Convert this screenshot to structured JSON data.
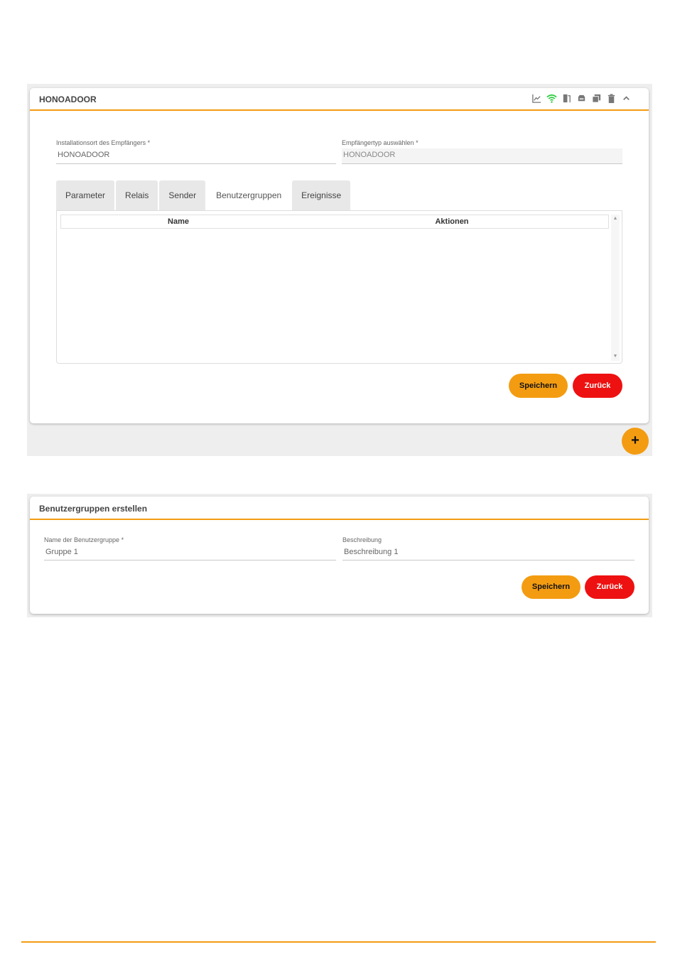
{
  "receiver_card": {
    "title": "HONOADOOR",
    "header_icons": [
      "chart-icon",
      "wifi-icon",
      "door-icon",
      "device-icon",
      "copy-icon",
      "trash-icon",
      "chevron-up-icon"
    ],
    "install_location_label": "Installationsort des Empfängers *",
    "install_location_value": "HONOADOOR",
    "receiver_type_label": "Empfängertyp auswählen *",
    "receiver_type_value": "HONOADOOR",
    "tabs": [
      {
        "label": "Parameter"
      },
      {
        "label": "Relais"
      },
      {
        "label": "Sender"
      },
      {
        "label": "Benutzergruppen",
        "active": true
      },
      {
        "label": "Ereignisse"
      }
    ],
    "table": {
      "columns": [
        "Name",
        "Aktionen"
      ],
      "rows": []
    },
    "save_label": "Speichern",
    "back_label": "Zurück",
    "fab_label": "+"
  },
  "create_group_card": {
    "title": "Benutzergruppen erstellen",
    "name_label": "Name der Benutzergruppe *",
    "name_value": "Gruppe 1",
    "description_label": "Beschreibung",
    "description_value": "Beschreibung 1",
    "save_label": "Speichern",
    "back_label": "Zurück"
  },
  "colors": {
    "accent": "#f39c12",
    "danger": "#ee1111",
    "wifi": "#2ecc40"
  }
}
